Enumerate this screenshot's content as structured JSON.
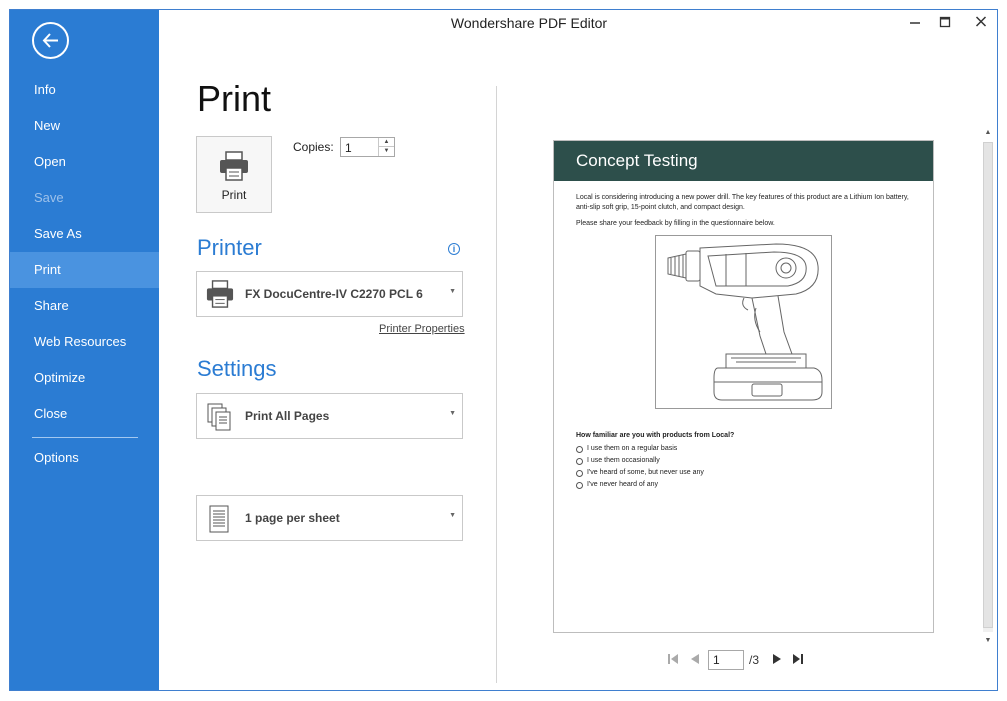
{
  "window": {
    "title": "Wondershare PDF Editor"
  },
  "sidebar": {
    "items": [
      {
        "label": "Info",
        "state": "normal"
      },
      {
        "label": "New",
        "state": "normal"
      },
      {
        "label": "Open",
        "state": "normal"
      },
      {
        "label": "Save",
        "state": "disabled"
      },
      {
        "label": "Save As",
        "state": "normal"
      },
      {
        "label": "Print",
        "state": "active"
      },
      {
        "label": "Share",
        "state": "normal"
      },
      {
        "label": "Web Resources",
        "state": "normal"
      },
      {
        "label": "Optimize",
        "state": "normal"
      },
      {
        "label": "Close",
        "state": "normal"
      }
    ],
    "options_label": "Options"
  },
  "print": {
    "heading": "Print",
    "button_label": "Print",
    "copies_label": "Copies:",
    "copies_value": "1"
  },
  "printer": {
    "heading": "Printer",
    "selected": "FX DocuCentre-IV C2270 PCL 6",
    "properties_link": "Printer Properties"
  },
  "settings": {
    "heading": "Settings",
    "pages_option": "Print All Pages",
    "layout_option": "1 page per sheet"
  },
  "preview": {
    "page_title": "Concept Testing",
    "intro": "Local is considering introducing a new power drill. The key features of this product are a Lithium Ion battery, anti-slip soft grip, 15-point clutch, and compact design.",
    "instruction": "Please share your feedback by filling in the questionnaire below.",
    "question": "How familiar are you with products from Local?",
    "options": [
      "I use them on a regular basis",
      "I use them occasionally",
      "I've heard of some, but never use any",
      "I've never heard of any"
    ]
  },
  "pager": {
    "current_page": "1",
    "total": "/3"
  },
  "colors": {
    "accent": "#2b7cd3",
    "active_item": "#4a93e0",
    "page_header": "#2d4f4b"
  }
}
